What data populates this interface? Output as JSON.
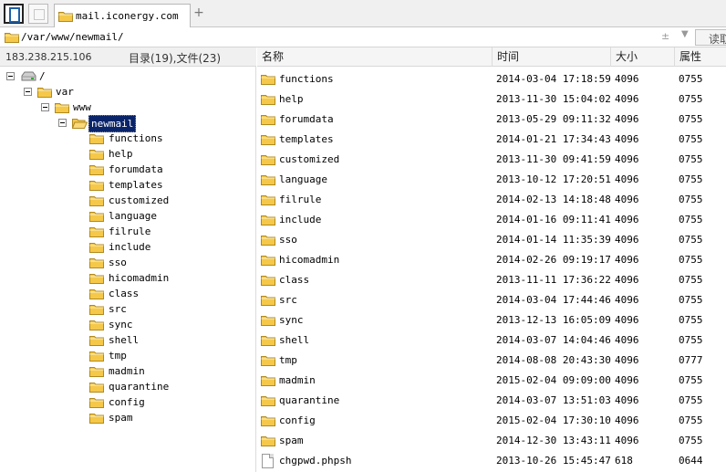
{
  "tab": {
    "title": "mail.iconergy.com"
  },
  "pathbar": {
    "path": "/var/www/newmail/",
    "read_button": "读取"
  },
  "left": {
    "ip": "183.238.215.106",
    "counts": "目录(19),文件(23)"
  },
  "tree": {
    "root": "/",
    "var": "var",
    "www": "www",
    "newmail": "newmail",
    "children": [
      "functions",
      "help",
      "forumdata",
      "templates",
      "customized",
      "language",
      "filrule",
      "include",
      "sso",
      "hicomadmin",
      "class",
      "src",
      "sync",
      "shell",
      "tmp",
      "madmin",
      "quarantine",
      "config",
      "spam"
    ]
  },
  "columns": {
    "name": "名称",
    "time": "时间",
    "size": "大小",
    "perm": "属性"
  },
  "files": [
    {
      "name": "functions",
      "time": "2014-03-04 17:18:59",
      "size": "4096",
      "perm": "0755",
      "type": "folder"
    },
    {
      "name": "help",
      "time": "2013-11-30 15:04:02",
      "size": "4096",
      "perm": "0755",
      "type": "folder"
    },
    {
      "name": "forumdata",
      "time": "2013-05-29 09:11:32",
      "size": "4096",
      "perm": "0755",
      "type": "folder"
    },
    {
      "name": "templates",
      "time": "2014-01-21 17:34:43",
      "size": "4096",
      "perm": "0755",
      "type": "folder"
    },
    {
      "name": "customized",
      "time": "2013-11-30 09:41:59",
      "size": "4096",
      "perm": "0755",
      "type": "folder"
    },
    {
      "name": "language",
      "time": "2013-10-12 17:20:51",
      "size": "4096",
      "perm": "0755",
      "type": "folder"
    },
    {
      "name": "filrule",
      "time": "2014-02-13 14:18:48",
      "size": "4096",
      "perm": "0755",
      "type": "folder"
    },
    {
      "name": "include",
      "time": "2014-01-16 09:11:41",
      "size": "4096",
      "perm": "0755",
      "type": "folder"
    },
    {
      "name": "sso",
      "time": "2014-01-14 11:35:39",
      "size": "4096",
      "perm": "0755",
      "type": "folder"
    },
    {
      "name": "hicomadmin",
      "time": "2014-02-26 09:19:17",
      "size": "4096",
      "perm": "0755",
      "type": "folder"
    },
    {
      "name": "class",
      "time": "2013-11-11 17:36:22",
      "size": "4096",
      "perm": "0755",
      "type": "folder"
    },
    {
      "name": "src",
      "time": "2014-03-04 17:44:46",
      "size": "4096",
      "perm": "0755",
      "type": "folder"
    },
    {
      "name": "sync",
      "time": "2013-12-13 16:05:09",
      "size": "4096",
      "perm": "0755",
      "type": "folder"
    },
    {
      "name": "shell",
      "time": "2014-03-07 14:04:46",
      "size": "4096",
      "perm": "0755",
      "type": "folder"
    },
    {
      "name": "tmp",
      "time": "2014-08-08 20:43:30",
      "size": "4096",
      "perm": "0777",
      "type": "folder"
    },
    {
      "name": "madmin",
      "time": "2015-02-04 09:09:00",
      "size": "4096",
      "perm": "0755",
      "type": "folder"
    },
    {
      "name": "quarantine",
      "time": "2014-03-07 13:51:03",
      "size": "4096",
      "perm": "0755",
      "type": "folder"
    },
    {
      "name": "config",
      "time": "2015-02-04 17:30:10",
      "size": "4096",
      "perm": "0755",
      "type": "folder"
    },
    {
      "name": "spam",
      "time": "2014-12-30 13:43:11",
      "size": "4096",
      "perm": "0755",
      "type": "folder"
    },
    {
      "name": "chgpwd.phpsh",
      "time": "2013-10-26 15:45:47",
      "size": "618",
      "perm": "0644",
      "type": "file"
    }
  ],
  "icons": {
    "folder": "folder-icon",
    "file": "file-icon",
    "drive": "drive-icon"
  },
  "colors": {
    "selection": "#0a246a",
    "folder_fill": "#f5c84a",
    "folder_stroke": "#b08a20"
  }
}
